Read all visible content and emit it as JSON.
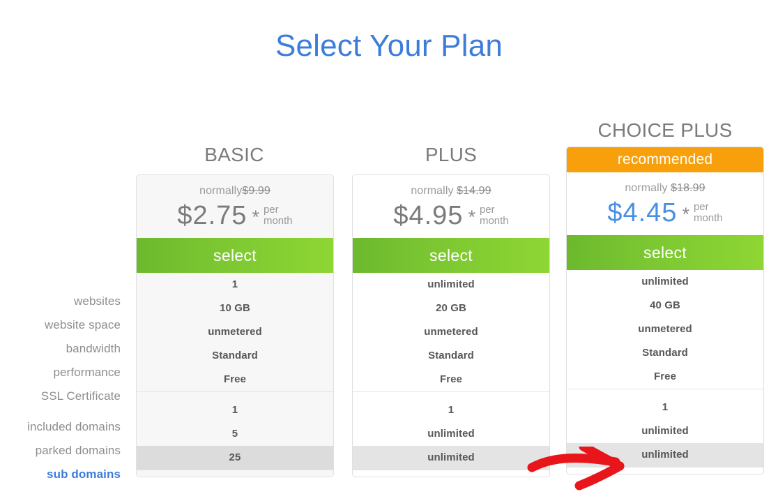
{
  "page": {
    "title": "Select Your Plan",
    "title_color": "#3c7ddb"
  },
  "colors": {
    "accent_blue": "#3c7ddb",
    "price_blue": "#4a90e2",
    "recommended_orange": "#f7a00b",
    "select_green": "#7dc832",
    "highlight_row": "#dcdcdc",
    "annotation_red": "#e8161a"
  },
  "plans": [
    {
      "name": "BASIC",
      "recommended_label": null,
      "normally_prefix": "normally",
      "normally_price": "$9.99",
      "price": "$2.75",
      "star": "*",
      "per": "per",
      "month": "month",
      "select_label": "select",
      "values": [
        "1",
        "10 GB",
        "unmetered",
        "Standard",
        "Free",
        "1",
        "5",
        "25"
      ]
    },
    {
      "name": "PLUS",
      "recommended_label": null,
      "normally_prefix": "normally",
      "normally_price": "$14.99",
      "price": "$4.95",
      "star": "*",
      "per": "per",
      "month": "month",
      "select_label": "select",
      "values": [
        "unlimited",
        "20 GB",
        "unmetered",
        "Standard",
        "Free",
        "1",
        "unlimited",
        "unlimited"
      ]
    },
    {
      "name": "CHOICE PLUS",
      "recommended_label": "recommended",
      "normally_prefix": "normally",
      "normally_price": "$18.99",
      "price": "$4.45",
      "star": "*",
      "per": "per",
      "month": "month",
      "select_label": "select",
      "values": [
        "unlimited",
        "40 GB",
        "unmetered",
        "Standard",
        "Free",
        "1",
        "unlimited",
        "unlimited"
      ]
    }
  ],
  "feature_labels": [
    "websites",
    "website space",
    "bandwidth",
    "performance",
    "SSL Certificate",
    "included domains",
    "parked domains",
    "sub domains"
  ],
  "highlighted_feature": "sub domains",
  "annotation": {
    "type": "arrow",
    "direction": "right",
    "points_to": "sub domains"
  }
}
